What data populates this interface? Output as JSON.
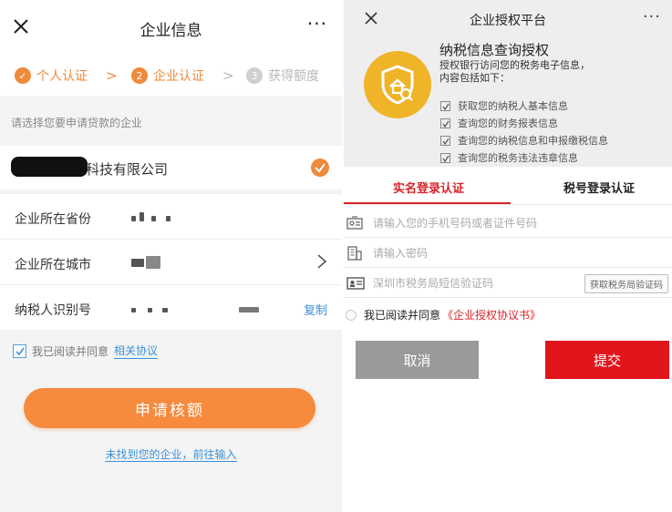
{
  "left": {
    "header": {
      "title": "企业信息",
      "more": "···"
    },
    "steps": [
      {
        "label": "个人认证",
        "marker": "✓"
      },
      {
        "label": "企业认证",
        "marker": "2"
      },
      {
        "label": "获得额度",
        "marker": "3"
      }
    ],
    "step_separator": ">",
    "hint": "请选择您要申请贷款的企业",
    "company": {
      "name_visible_part": "科技有限公司"
    },
    "rows": [
      {
        "label": "企业所在省份"
      },
      {
        "label": "企业所在城市"
      },
      {
        "label": "纳税人识别号",
        "action": "复制"
      }
    ],
    "agreement": {
      "text": "我已阅读并同意",
      "link": "相关协议"
    },
    "apply_button": "申请核额",
    "not_found_link": "未找到您的企业，前往输入",
    "colors": {
      "accent": "#f08a3c",
      "link": "#3b8fd8"
    }
  },
  "right": {
    "header": {
      "title": "企业授权平台",
      "more": "···"
    },
    "auth": {
      "title": "纳税信息查询授权",
      "desc_line1": "授权银行访问您的税务电子信息，",
      "desc_line2": "内容包括如下：",
      "items": [
        "获取您的纳税人基本信息",
        "查询您的财务报表信息",
        "查询您的纳税信息和申报缴税信息",
        "查询您的税务违法违章信息"
      ]
    },
    "tabs": [
      "实名登录认证",
      "税号登录认证"
    ],
    "fields": {
      "phone_placeholder": "请输入您的手机号码或者证件号码",
      "password_placeholder": "请输入密码",
      "sms_placeholder": "深圳市税务局短信验证码",
      "sms_button": "获取税务局验证码"
    },
    "agreement": {
      "text": "我已阅读并同意",
      "link": "《企业授权协议书》"
    },
    "cancel_button": "取消",
    "submit_button": "提交",
    "colors": {
      "accent": "#d9252b",
      "badge": "#f0b429"
    }
  }
}
